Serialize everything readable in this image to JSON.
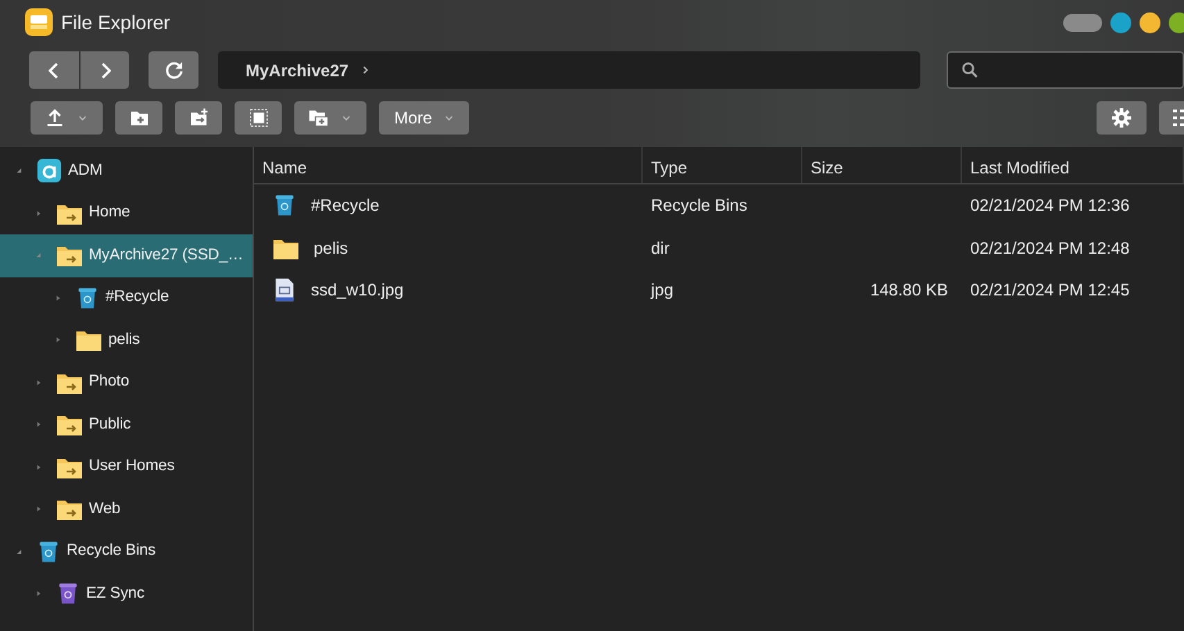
{
  "window": {
    "title": "File Explorer"
  },
  "path": {
    "segments": [
      "MyArchive27"
    ]
  },
  "toolbar": [
    {
      "kind": "upload",
      "dropdown": true
    },
    {
      "kind": "new-folder",
      "dropdown": false
    },
    {
      "kind": "new-share",
      "dropdown": false
    },
    {
      "kind": "select",
      "dropdown": false
    },
    {
      "kind": "copy",
      "dropdown": true
    },
    {
      "kind": "text",
      "label": "More",
      "dropdown": true
    }
  ],
  "sidebar": {
    "items": [
      {
        "label": "ADM",
        "kind": "adm",
        "expanded": true,
        "selected": false,
        "children": [
          {
            "label": "Home",
            "kind": "share",
            "expanded": false,
            "selected": false
          },
          {
            "label": "MyArchive27 (SSD_…",
            "kind": "share",
            "expanded": true,
            "selected": true,
            "children": [
              {
                "label": "#Recycle",
                "kind": "bin",
                "expanded": false,
                "selected": false
              },
              {
                "label": "pelis",
                "kind": "folder",
                "expanded": false,
                "selected": false
              }
            ]
          },
          {
            "label": "Photo",
            "kind": "share",
            "expanded": false,
            "selected": false
          },
          {
            "label": "Public",
            "kind": "share",
            "expanded": false,
            "selected": false
          },
          {
            "label": "User Homes",
            "kind": "share",
            "expanded": false,
            "selected": false
          },
          {
            "label": "Web",
            "kind": "share",
            "expanded": false,
            "selected": false
          }
        ]
      },
      {
        "label": "Recycle Bins",
        "kind": "bin",
        "expanded": true,
        "selected": false,
        "children": [
          {
            "label": "EZ Sync",
            "kind": "bin-purple",
            "expanded": false,
            "selected": false
          }
        ]
      }
    ]
  },
  "table": {
    "columns": [
      "Name",
      "Type",
      "Size",
      "Last Modified"
    ],
    "rows": [
      {
        "kind": "bin",
        "name": "#Recycle",
        "type": "Recycle Bins",
        "modified": "02/21/2024 PM 12:36"
      },
      {
        "kind": "folder",
        "name": "pelis",
        "type": "dir",
        "modified": "02/21/2024 PM 12:48"
      },
      {
        "kind": "image",
        "name": "ssd_w10.jpg",
        "type": "jpg",
        "size": "148.80 KB",
        "modified": "02/21/2024 PM 12:45"
      }
    ]
  }
}
